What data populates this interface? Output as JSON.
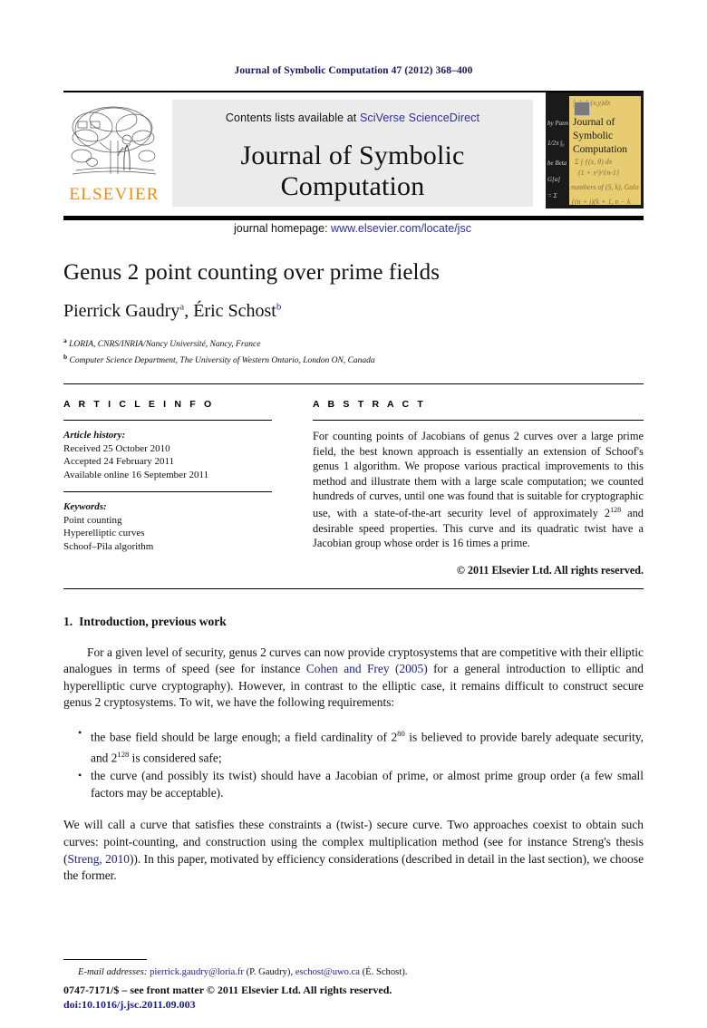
{
  "running_head": "Journal of Symbolic Computation 47 (2012) 368–400",
  "masthead": {
    "publisher_name": "ELSEVIER",
    "contents_prefix": "Contents lists available at ",
    "contents_link": "SciVerse ScienceDirect",
    "journal_name": "Journal of Symbolic Computation",
    "homepage_prefix": "journal homepage: ",
    "homepage_link": "www.elsevier.com/locate/jsc",
    "cover_title_line1": "Journal of",
    "cover_title_line2": "Symbolic",
    "cover_title_line3": "Computation"
  },
  "title": "Genus 2 point counting over prime fields",
  "authors": {
    "author1": "Pierrick Gaudry",
    "author1_sup": "a",
    "separator": ", ",
    "author2": "Éric Schost",
    "author2_sup": "b"
  },
  "affiliations": [
    {
      "marker": "a",
      "text": "LORIA, CNRS/INRIA/Nancy Université, Nancy, France"
    },
    {
      "marker": "b",
      "text": "Computer Science Department, The University of Western Ontario, London ON, Canada"
    }
  ],
  "article_info": {
    "heading": "A R T I C L E    I N F O",
    "history_label": "Article history:",
    "history": [
      "Received 25 October 2010",
      "Accepted 24 February 2011",
      "Available online 16 September 2011"
    ],
    "keywords_label": "Keywords:",
    "keywords": [
      "Point counting",
      "Hyperelliptic curves",
      "Schoof–Pila algorithm"
    ]
  },
  "abstract": {
    "heading": "A B S T R A C T",
    "part1": "For counting points of Jacobians of genus 2 curves over a large prime field, the best known approach is essentially an extension of Schoof's genus 1 algorithm. We propose various practical improvements to this method and illustrate them with a large scale computation; we counted hundreds of curves, until one was found that is suitable for cryptographic use, with a state-of-the-art security level of approximately 2",
    "sup1": "128",
    "part2": " and desirable speed properties. This curve and its quadratic twist have a Jacobian group whose order is 16 times a prime.",
    "copyright": "© 2011 Elsevier Ltd. All rights reserved."
  },
  "section": {
    "number": "1.",
    "title": "Introduction, previous work"
  },
  "paragraphs": {
    "p1_a": "For a given level of security, genus 2 curves can now provide cryptosystems that are competitive with their elliptic analogues in terms of speed (see for instance ",
    "p1_cite": "Cohen and Frey (2005)",
    "p1_b": " for a general introduction to elliptic and hyperelliptic curve cryptography). However, in contrast to the elliptic case, it remains difficult to construct secure genus 2 cryptosystems. To wit, we have the following requirements:",
    "bullet1_a": "the base field should be large enough; a field cardinality of 2",
    "bullet1_sup1": "80",
    "bullet1_b": " is believed to provide barely adequate security, and 2",
    "bullet1_sup2": "128",
    "bullet1_c": " is considered safe;",
    "bullet2": "the curve (and possibly its twist) should have a Jacobian of prime, or almost prime group order (a few small factors may be acceptable).",
    "p2_a": "We will call a curve that satisfies these constraints a (twist-) secure curve. Two approaches coexist to obtain such curves: point-counting, and construction using the complex multiplication method (see for instance Streng's thesis (",
    "p2_cite": "Streng, 2010",
    "p2_b": ")). In this paper, motivated by efficiency considerations (described in detail in the last section), we choose the former."
  },
  "footnote": {
    "label": "E-mail addresses:",
    "email1": "pierrick.gaudry@loria.fr",
    "name1": " (P. Gaudry), ",
    "email2": "eschost@uwo.ca",
    "name2": " (É. Schost)."
  },
  "footer": {
    "front_matter": "0747-7171/$ – see front matter © 2011 Elsevier Ltd. All rights reserved.",
    "doi": "doi:10.1016/j.jsc.2011.09.003"
  },
  "colors": {
    "link": "#1d1d8e",
    "running_head": "#17195e",
    "elsevier_orange": "#f08c1a",
    "masthead_bg": "#ebebeb",
    "cover_yellow": "#e8cc72"
  }
}
